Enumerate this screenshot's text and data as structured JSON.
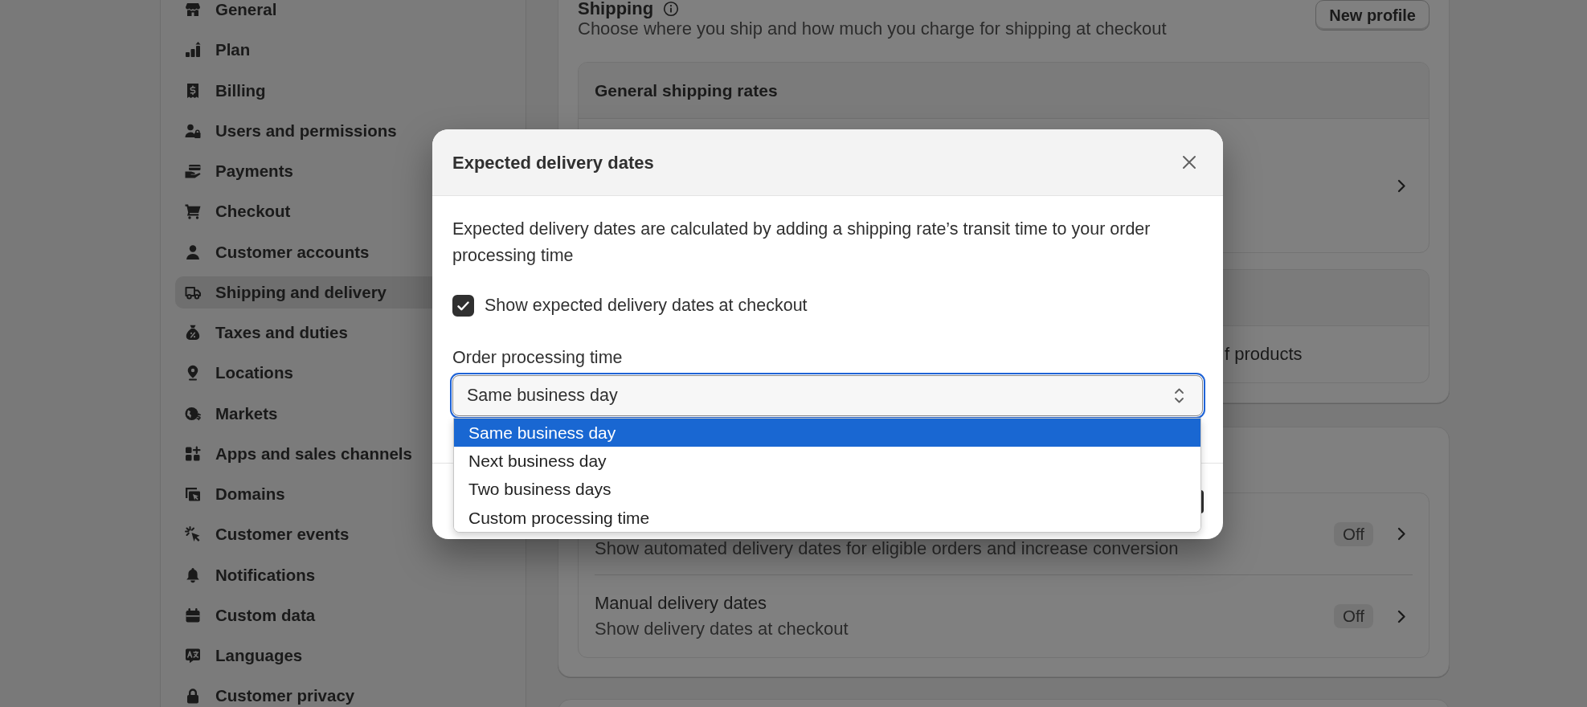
{
  "sidebar": {
    "items": [
      {
        "label": "General",
        "selected": false
      },
      {
        "label": "Plan",
        "selected": false
      },
      {
        "label": "Billing",
        "selected": false
      },
      {
        "label": "Users and permissions",
        "selected": false
      },
      {
        "label": "Payments",
        "selected": false
      },
      {
        "label": "Checkout",
        "selected": false
      },
      {
        "label": "Customer accounts",
        "selected": false
      },
      {
        "label": "Shipping and delivery",
        "selected": true
      },
      {
        "label": "Taxes and duties",
        "selected": false
      },
      {
        "label": "Locations",
        "selected": false
      },
      {
        "label": "Markets",
        "selected": false
      },
      {
        "label": "Apps and sales channels",
        "selected": false
      },
      {
        "label": "Domains",
        "selected": false
      },
      {
        "label": "Customer events",
        "selected": false
      },
      {
        "label": "Notifications",
        "selected": false
      },
      {
        "label": "Custom data",
        "selected": false
      },
      {
        "label": "Languages",
        "selected": false
      },
      {
        "label": "Customer privacy",
        "selected": false
      }
    ]
  },
  "shipping": {
    "title": "Shipping",
    "description": "Choose where you ship and how much you charge for shipping at checkout",
    "button": "New profile",
    "profiles": [
      {
        "title": "General shipping rates"
      },
      {
        "detail": "f products"
      }
    ]
  },
  "delivery": {
    "options": [
      {
        "description": "Show automated delivery dates for eligible orders and increase conversion",
        "status": "Off"
      },
      {
        "title": "Manual delivery dates",
        "description": "Show delivery dates at checkout",
        "status": "Off"
      }
    ]
  },
  "modal": {
    "title": "Expected delivery dates",
    "description": "Expected delivery dates are calculated by adding a shipping rate’s transit time to your order processing time",
    "checkbox": {
      "label": "Show expected delivery dates at checkout",
      "checked": true
    },
    "select": {
      "label": "Order processing time",
      "value": "Same business day",
      "focused": true,
      "options": [
        {
          "label": "Same business day",
          "selected": true
        },
        {
          "label": "Next business day",
          "selected": false
        },
        {
          "label": "Two business days",
          "selected": false
        },
        {
          "label": "Custom processing time",
          "selected": false
        }
      ]
    }
  }
}
